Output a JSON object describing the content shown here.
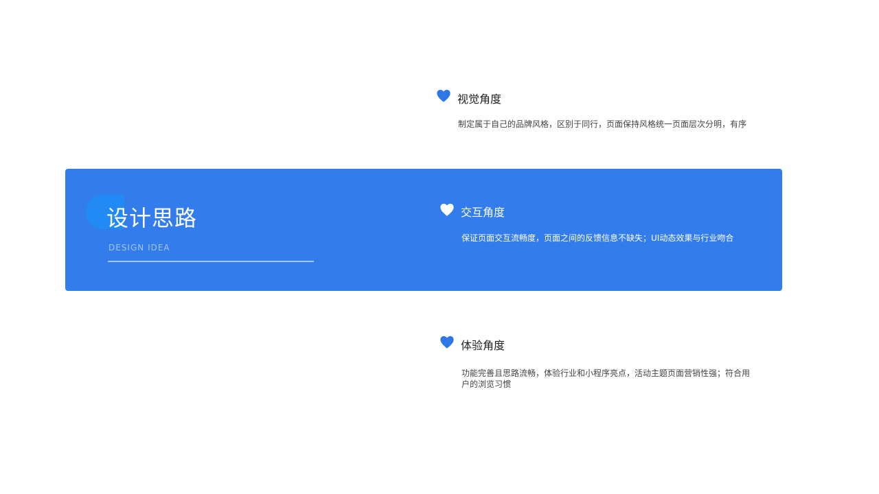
{
  "colors": {
    "accent": "#327cec",
    "accent_light": "#1f8cf6",
    "heart_blue": "#2f76e6",
    "heart_white": "#ffffff"
  },
  "section": {
    "title": "设计思路",
    "subtitle": "DESIGN IDEA"
  },
  "items": [
    {
      "icon": "heart-icon",
      "title": "视觉角度",
      "desc": "制定属于自己的品牌风格，区别于同行，页面保持风格统一页面层次分明，有序"
    },
    {
      "icon": "heart-icon",
      "title": "交互角度",
      "desc": "保证页面交互流畅度，页面之间的反馈信息不缺失；UI动态效果与行业吻合"
    },
    {
      "icon": "heart-icon",
      "title": "体验角度",
      "desc": "功能完善且思路流畅，体验行业和小程序亮点，活动主题页面营销性强；符合用户的浏览习惯"
    }
  ]
}
